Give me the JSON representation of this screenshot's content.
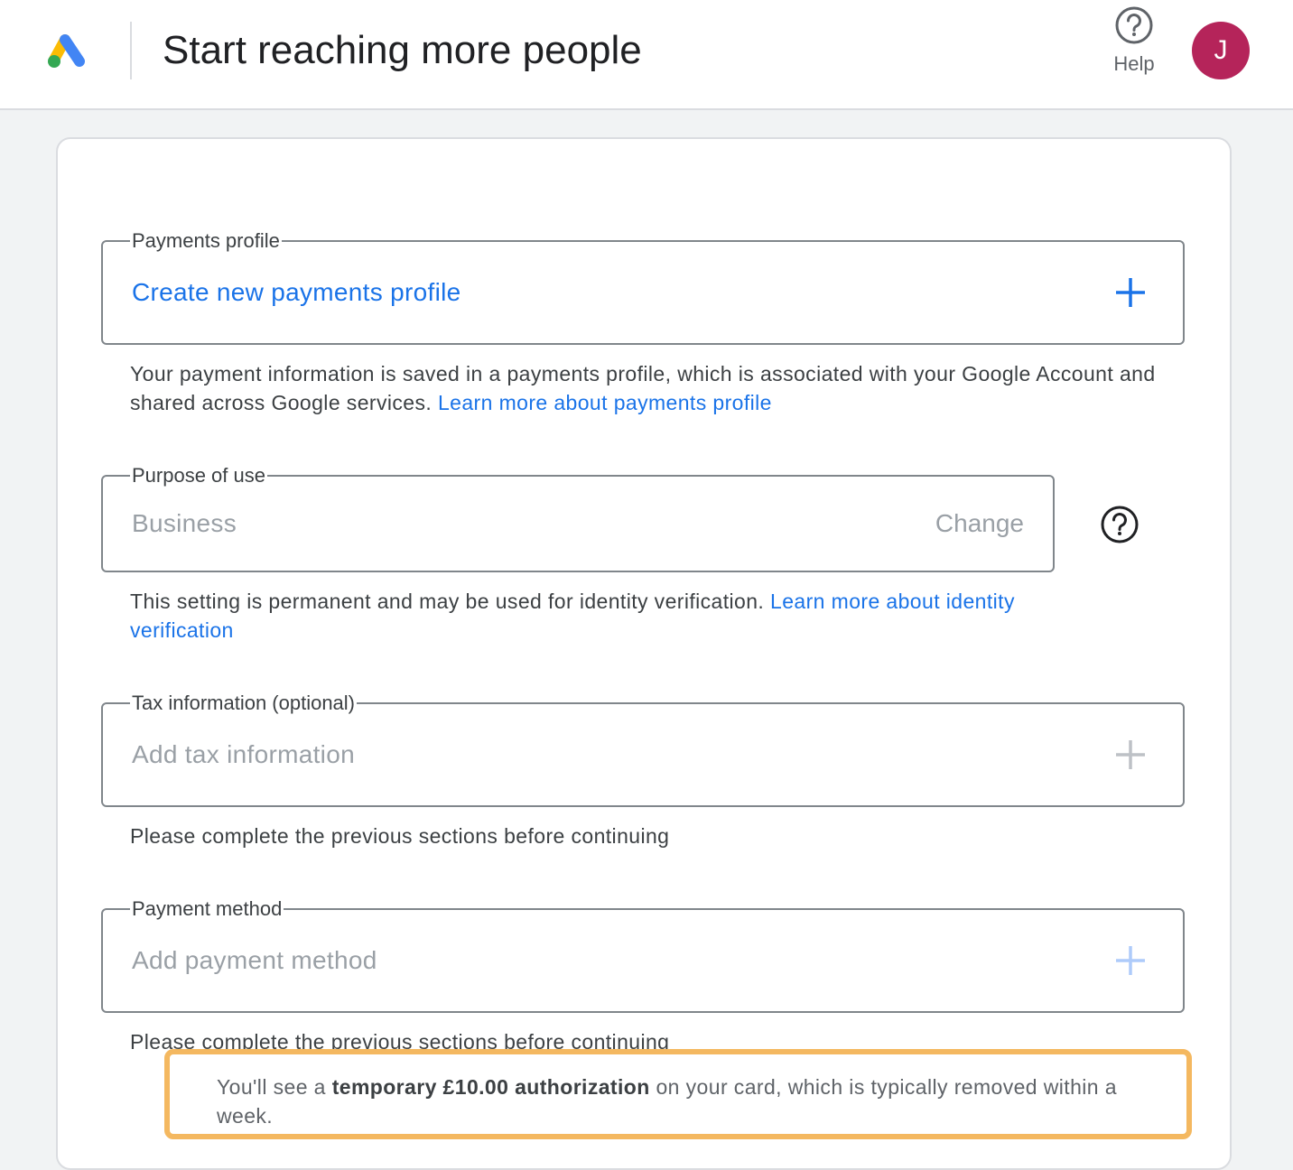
{
  "header": {
    "title": "Start reaching more people",
    "help_label": "Help",
    "avatar_initial": "J",
    "logo_icon": "google-ads-logo"
  },
  "payments_profile": {
    "legend": "Payments profile",
    "value": "Create new payments profile",
    "description": "Your payment information is saved in a payments profile, which is associated with your Google Account and shared across Google services.",
    "link": "Learn more about payments profile"
  },
  "purpose": {
    "legend": "Purpose of use",
    "value": "Business",
    "change_label": "Change",
    "description": "This setting is permanent and may be used for identity verification.",
    "link": "Learn more about identity verification"
  },
  "tax": {
    "legend": "Tax information (optional)",
    "value": "Add tax information",
    "description": "Please complete the previous sections before continuing"
  },
  "payment_method": {
    "legend": "Payment method",
    "value": "Add payment method",
    "description": "Please complete the previous sections before continuing"
  },
  "authorization_note": {
    "prefix": "You'll see a",
    "bold": "temporary £10.00 authorization",
    "suffix": "on your card, which is typically removed within a week."
  },
  "colors": {
    "accent": "#1a73e8",
    "avatar": "#b5245a",
    "highlight": "#f4b860",
    "disabled": "#9aa0a6"
  }
}
